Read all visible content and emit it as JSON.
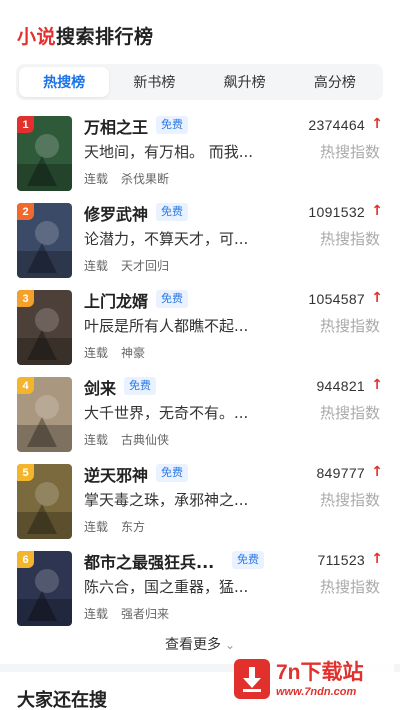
{
  "header": {
    "accent": "小说",
    "rest": "搜索排行榜"
  },
  "tabs": [
    {
      "label": "热搜榜",
      "active": true
    },
    {
      "label": "新书榜",
      "active": false
    },
    {
      "label": "飙升榜",
      "active": false
    },
    {
      "label": "高分榜",
      "active": false
    }
  ],
  "free_label": "免费",
  "heat_label": "热搜指数",
  "books": [
    {
      "rank": "1",
      "title": "万相之王",
      "desc": "天地间，有万相。 而我...",
      "status": "连载",
      "genre": "杀伐果断",
      "count": "2374464",
      "rank_color": "#e2312d",
      "cover_color": "#2f5a3a"
    },
    {
      "rank": "2",
      "title": "修罗武神",
      "desc": "论潜力，不算天才，可...",
      "status": "连载",
      "genre": "天才回归",
      "count": "1091532",
      "rank_color": "#f06a2d",
      "cover_color": "#3b4a66"
    },
    {
      "rank": "3",
      "title": "上门龙婿",
      "desc": "叶辰是所有人都瞧不起...",
      "status": "连载",
      "genre": "神豪",
      "count": "1054587",
      "rank_color": "#f3a12b",
      "cover_color": "#4d4038"
    },
    {
      "rank": "4",
      "title": "剑来",
      "desc": "大千世界，无奇不有。...",
      "status": "连载",
      "genre": "古典仙侠",
      "count": "944821",
      "rank_color": "#f3b52b",
      "cover_color": "#a9977f"
    },
    {
      "rank": "5",
      "title": "逆天邪神",
      "desc": "掌天毒之珠，承邪神之...",
      "status": "连载",
      "genre": "东方",
      "count": "849777",
      "rank_color": "#f3b52b",
      "cover_color": "#7a6a3e"
    },
    {
      "rank": "6",
      "title": "都市之最强狂兵...",
      "desc": "陈六合，国之重器，猛...",
      "status": "连载",
      "genre": "强者归来",
      "count": "711523",
      "rank_color": "#f3b52b",
      "cover_color": "#2d3550"
    }
  ],
  "more": {
    "label": "查看更多"
  },
  "section2": {
    "title": "大家还在搜"
  },
  "watermark": {
    "title": "7n下载站",
    "url": "www.7ndn.com"
  }
}
